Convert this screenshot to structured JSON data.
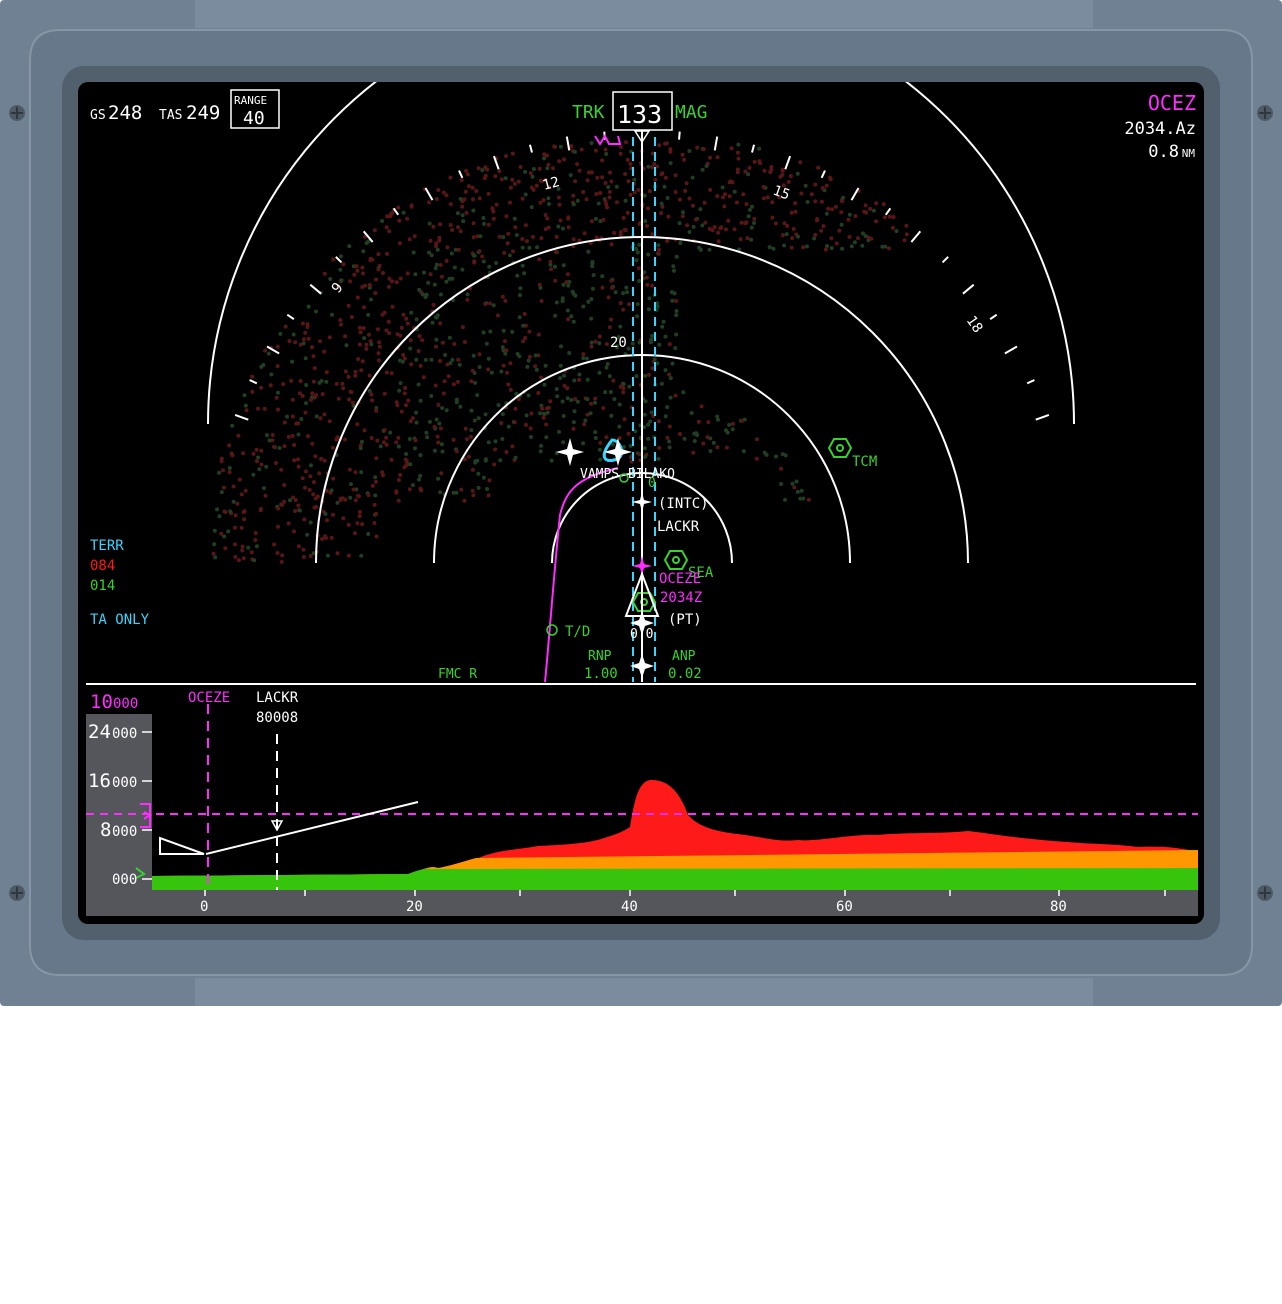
{
  "header": {
    "gs_label": "GS",
    "gs_value": "248",
    "tas_label": "TAS",
    "tas_value": "249",
    "range_label": "RANGE",
    "range_value": "40",
    "trk_label": "TRK",
    "heading": "133",
    "mag_label": "MAG",
    "wpt_name": "OCEZ",
    "wpt_time": "2034.Az",
    "wpt_dist": "0.8",
    "wpt_dist_unit": "NM"
  },
  "compass": {
    "labels": [
      "9",
      "12",
      "15",
      "18"
    ],
    "range_mark": "20"
  },
  "terrain_box": {
    "title": "TERR",
    "high": "084",
    "low": "014",
    "mode": "TA ONLY"
  },
  "map": {
    "vamps": "VAMPS",
    "bilako": "BILAKO",
    "intc": "(INTC)",
    "lackr": "LACKR",
    "sea": "SEA",
    "oceze": "OCEZE",
    "eta": "2034Z",
    "pt": "(PT)",
    "dist": "0.0",
    "td": "T/D",
    "tcm": "TCM",
    "co": "0",
    "fmc": "FMC R",
    "rnp_label": "RNP",
    "rnp_value": "1.00",
    "anp_label": "ANP",
    "anp_value": "0.02"
  },
  "vsd": {
    "alt_sel_big": "10",
    "alt_sel_small": "000",
    "oceze": "OCEZE",
    "lackr": "LACKR",
    "lackr_alt": "80008",
    "alt_ticks": [
      {
        "big": "24",
        "small": "000"
      },
      {
        "big": "16",
        "small": "000"
      },
      {
        "big": "8",
        "small": "000"
      },
      {
        "big": "",
        "small": "000"
      }
    ],
    "dist_ticks": [
      "0",
      "20",
      "40",
      "60",
      "80"
    ]
  },
  "colors": {
    "magenta": "#ff2bff",
    "green": "#39d12f",
    "cyan": "#35d6ff",
    "red": "#ff1a1a",
    "amber": "#ff9700",
    "white": "#ffffff",
    "bezel": "#6b7d8e"
  },
  "icons": [
    "screw-icon",
    "airplane-symbol-icon",
    "vortac-icon",
    "waypoint-star-icon",
    "runway-icon"
  ]
}
